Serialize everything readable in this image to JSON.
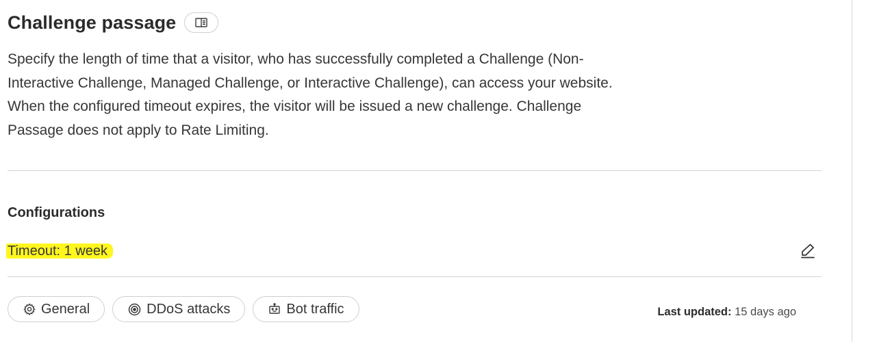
{
  "header": {
    "title": "Challenge passage",
    "doc_icon": "book-open-icon"
  },
  "description": "Specify the length of time that a visitor, who has successfully completed a Challenge (Non-Interactive Challenge, Managed Challenge, or Interactive Challenge), can access your website. When the configured timeout expires, the visitor will be issued a new challenge. Challenge Passage does not apply to Rate Limiting.",
  "configurations": {
    "heading": "Configurations",
    "timeout_text": "Timeout: 1 week",
    "highlight_color": "#fff61f",
    "edit_icon": "pencil-icon"
  },
  "tags": [
    {
      "label": "General",
      "icon": "gear-icon"
    },
    {
      "label": "DDoS attacks",
      "icon": "target-icon"
    },
    {
      "label": "Bot traffic",
      "icon": "robot-icon"
    }
  ],
  "footer": {
    "last_updated_label": "Last updated:",
    "last_updated_value": "15 days ago"
  }
}
